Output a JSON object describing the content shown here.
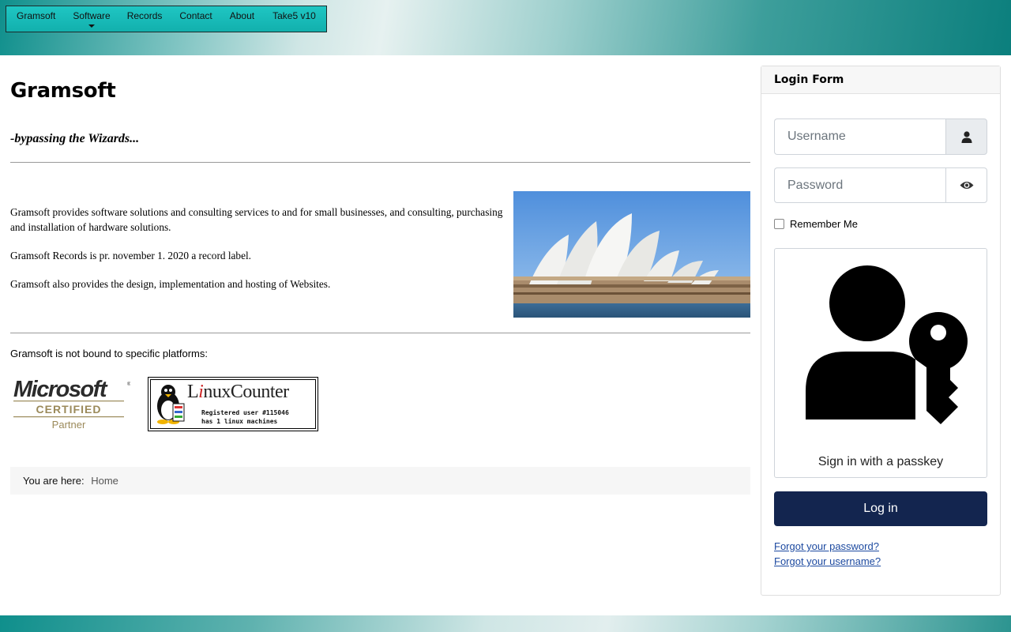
{
  "nav": {
    "items": [
      {
        "label": "Gramsoft"
      },
      {
        "label": "Software"
      },
      {
        "label": "Records"
      },
      {
        "label": "Contact"
      },
      {
        "label": "About"
      },
      {
        "label": "Take5 v10"
      }
    ]
  },
  "main": {
    "title": "Gramsoft",
    "tagline": "-bypassing the Wizards...",
    "paragraphs": [
      "Gramsoft provides software solutions and consulting services to and for small businesses, and consulting, purchasing and installation of hardware solutions.",
      "Gramsoft Records is pr. november 1. 2020 a record label.",
      "Gramsoft also provides the design, implementation and hosting of Websites."
    ],
    "platforms_text": "Gramsoft is not bound to specific platforms:",
    "ms_logo": {
      "line1": "Microsoft",
      "line2": "CERTIFIED",
      "line3": "Partner"
    },
    "linux_counter": {
      "title_pre": "L",
      "title_i": "i",
      "title_post": "nuxCounter",
      "line1": "Registered user #115046",
      "line2": "has 1 linux machines"
    }
  },
  "breadcrumb": {
    "label": "You are here:",
    "home": "Home"
  },
  "login": {
    "header": "Login Form",
    "username_placeholder": "Username",
    "password_placeholder": "Password",
    "remember_label": "Remember Me",
    "passkey_label": "Sign in with a passkey",
    "login_button": "Log in",
    "forgot_password": "Forgot your password?",
    "forgot_username": "Forgot your username?"
  },
  "colors": {
    "brand_teal": "#12b0ad",
    "login_button": "#13254f",
    "link": "#1d4aa0"
  }
}
